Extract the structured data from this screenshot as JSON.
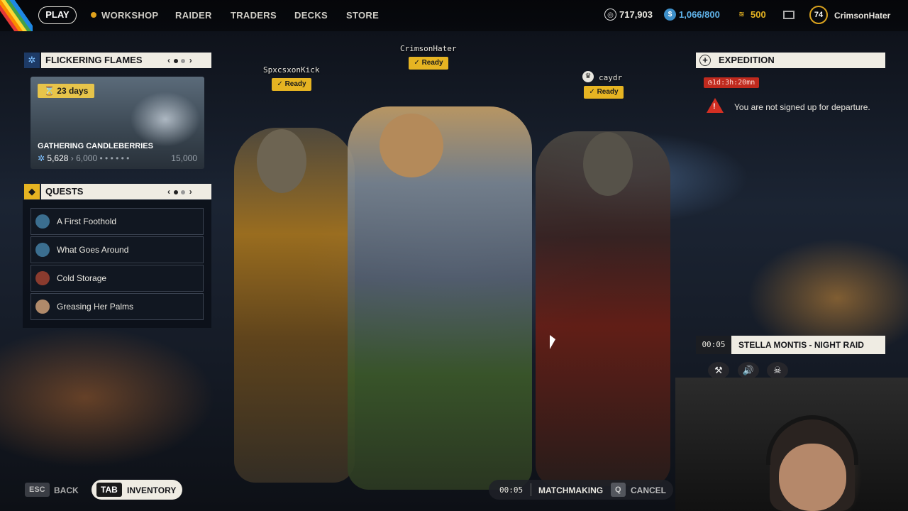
{
  "nav": {
    "play": "PLAY",
    "workshop": "WORKSHOP",
    "raider": "RAIDER",
    "traders": "TRADERS",
    "decks": "DECKS",
    "store": "STORE"
  },
  "currencies": {
    "coins": "717,903",
    "raider_tokens": "1,066/800",
    "cred": "500"
  },
  "user": {
    "level": "74",
    "name": "CrimsonHater"
  },
  "event": {
    "title": "FLICKERING FLAMES",
    "days": "23 days",
    "name": "GATHERING CANDLEBERRIES",
    "current": "5,628",
    "next": "6,000",
    "max": "15,000"
  },
  "quests": {
    "title": "QUESTS",
    "items": [
      {
        "label": "A First Foothold",
        "color": "#3b6e8f"
      },
      {
        "label": "What Goes Around",
        "color": "#3b6e8f"
      },
      {
        "label": "Cold Storage",
        "color": "#8a3b2e"
      },
      {
        "label": "Greasing Her Palms",
        "color": "#b08a6a"
      }
    ]
  },
  "players": {
    "p1": {
      "name": "SpxcsxonKick",
      "status": "✓ Ready"
    },
    "p2": {
      "name": "CrimsonHater",
      "status": "✓ Ready"
    },
    "p3": {
      "name": "caydr",
      "status": "✓ Ready"
    }
  },
  "expedition": {
    "title": "EXPEDITION",
    "timer": "1d:3h:20mn",
    "message": "You are not signed up for departure."
  },
  "map": {
    "time": "00:05",
    "name": "STELLA MONTIS - NIGHT RAID"
  },
  "bottom": {
    "esc_key": "ESC",
    "back": "BACK",
    "tab_key": "TAB",
    "inventory": "INVENTORY",
    "mm_time": "00:05",
    "matchmaking": "MATCHMAKING",
    "q_key": "Q",
    "cancel": "CANCEL"
  },
  "colors": {
    "accent_gold": "#e6b422",
    "panel_light": "#efece3",
    "warn_red": "#d32f23"
  }
}
